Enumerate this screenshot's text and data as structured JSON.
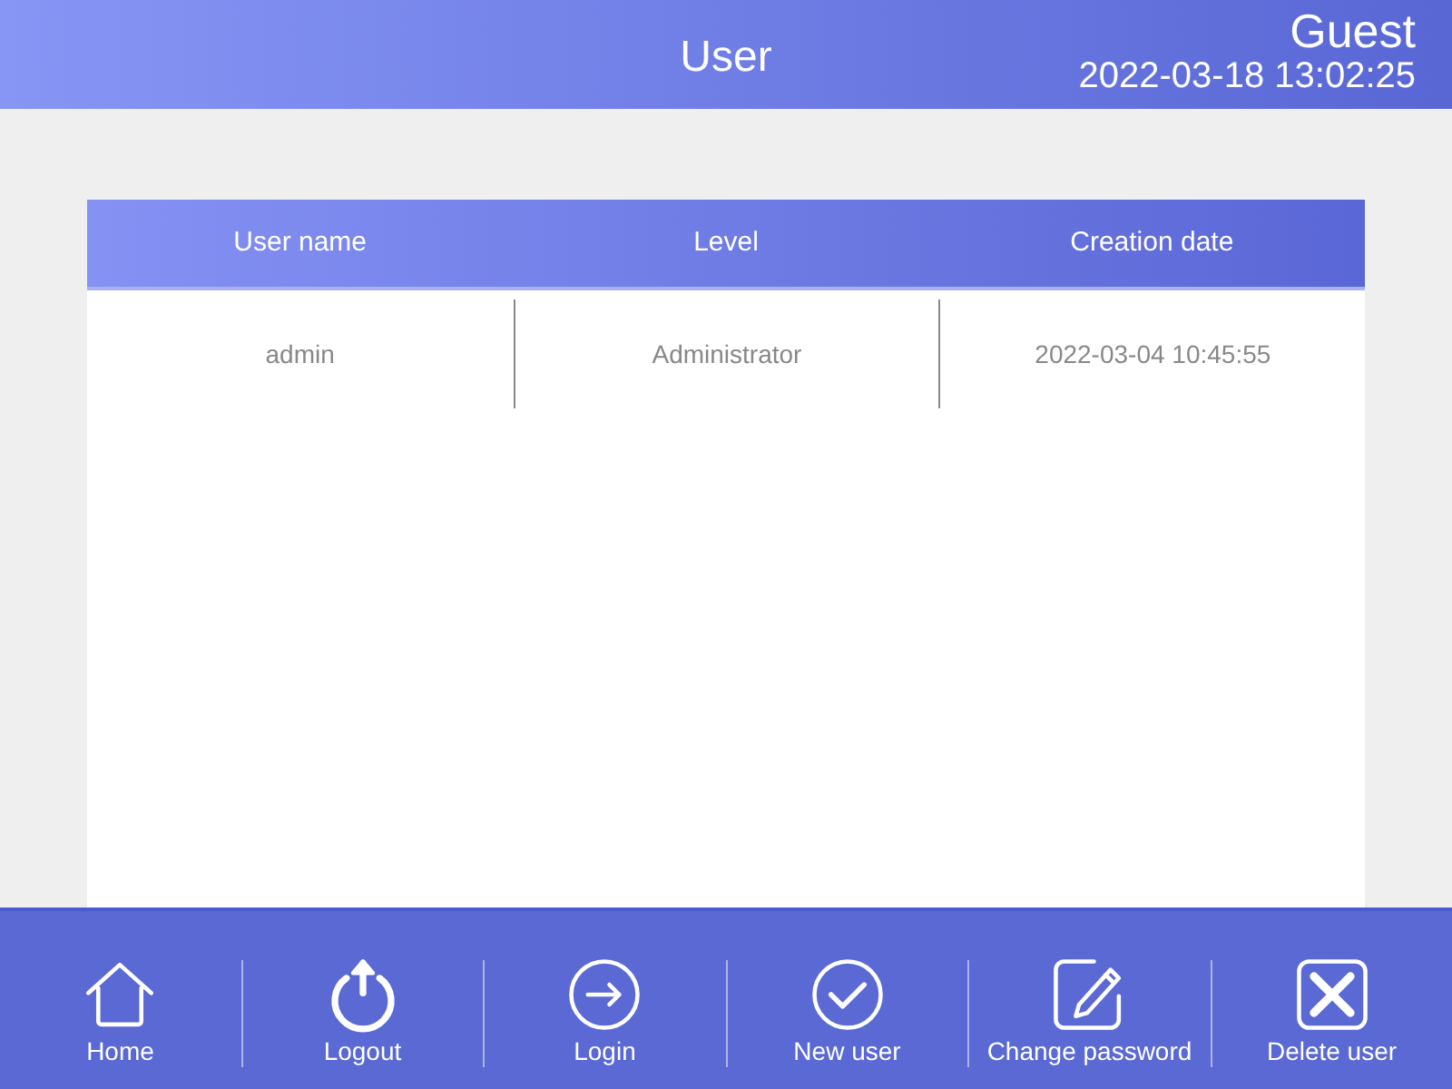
{
  "window": {
    "title": "User",
    "user": "Guest",
    "datetime": "2022-03-18 13:02:25"
  },
  "table": {
    "columns": [
      "User name",
      "Level",
      "Creation date"
    ],
    "rows": [
      [
        "admin",
        "Administrator",
        "2022-03-04 10:45:55"
      ]
    ]
  },
  "toolbar": [
    {
      "kind": "home",
      "label": "Home"
    },
    {
      "kind": "logout",
      "label": "Logout"
    },
    {
      "kind": "login",
      "label": "Login"
    },
    {
      "kind": "new",
      "label": "New user"
    },
    {
      "kind": "password",
      "label": "Change password"
    },
    {
      "kind": "delete",
      "label": "Delete user"
    }
  ]
}
